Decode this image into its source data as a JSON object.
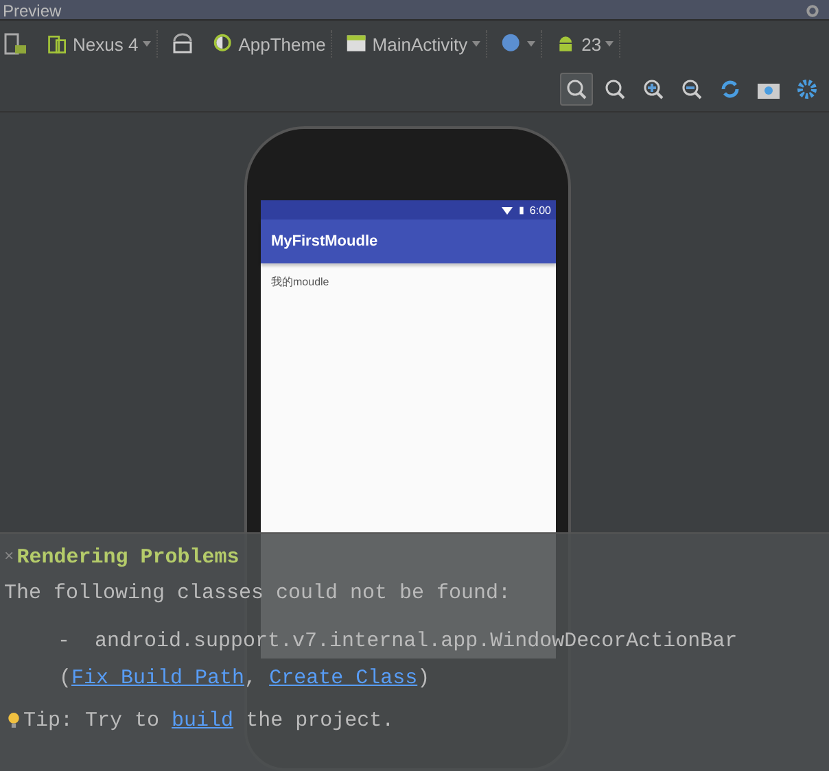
{
  "panel_title": "Preview",
  "toolbar": {
    "device": "Nexus 4",
    "theme": "AppTheme",
    "activity": "MainActivity",
    "api": "23"
  },
  "phone": {
    "status_time": "6:00",
    "app_title": "MyFirstMoudle",
    "content_text": "我的moudle"
  },
  "render_panel": {
    "close": "×",
    "title": "Rendering Problems",
    "intro": "The following classes could not be found:",
    "missing_classes": [
      {
        "bullet": "-",
        "name": "android.support.v7.internal.app.WindowDecorActionBar",
        "open": "(",
        "links": [
          "Fix Build Path",
          "Create Class"
        ],
        "separator": ",",
        "close": ")"
      }
    ],
    "tip": {
      "label": "Tip: Try to",
      "link": "build",
      "rest": "the project."
    }
  }
}
